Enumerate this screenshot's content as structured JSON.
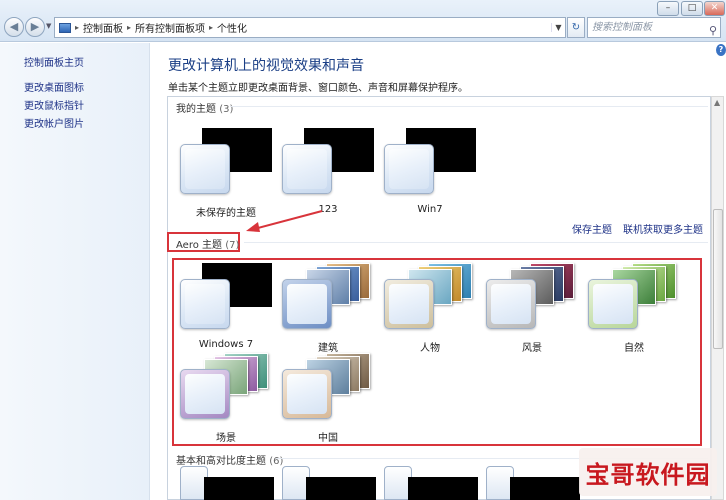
{
  "breadcrumb": [
    "控制面板",
    "所有控制面板项",
    "个性化"
  ],
  "search": {
    "placeholder": "搜索控制面板"
  },
  "icons": {
    "back": "back-arrow-icon",
    "forward": "forward-arrow-icon",
    "refresh": "refresh-icon",
    "search": "search-icon",
    "help": "help-icon"
  },
  "sidebar": {
    "items": [
      {
        "label": "控制面板主页"
      },
      {
        "label": "更改桌面图标"
      },
      {
        "label": "更改鼠标指针"
      },
      {
        "label": "更改帐户图片"
      }
    ]
  },
  "main": {
    "title": "更改计算机上的视觉效果和声音",
    "description": "单击某个主题立即更改桌面背景、窗口颜色、声音和屏幕保护程序。"
  },
  "my_themes": {
    "heading": "我的主题",
    "count": "(3)",
    "items": [
      {
        "name": "未保存的主题"
      },
      {
        "name": "123"
      },
      {
        "name": "Win7"
      }
    ],
    "save_link": "保存主题",
    "online_link": "联机获取更多主题"
  },
  "aero_themes": {
    "heading": "Aero 主题",
    "count": "(7)",
    "items": [
      {
        "name": "Windows 7"
      },
      {
        "name": "建筑"
      },
      {
        "name": "人物"
      },
      {
        "name": "风景"
      },
      {
        "name": "自然"
      },
      {
        "name": "场景"
      },
      {
        "name": "中国"
      }
    ]
  },
  "basic_themes": {
    "heading": "基本和高对比度主题",
    "count": "(6)"
  },
  "watermark": "宝哥软件园",
  "colors": {
    "accent": "#1e3287",
    "highlight": "#d8343b"
  }
}
